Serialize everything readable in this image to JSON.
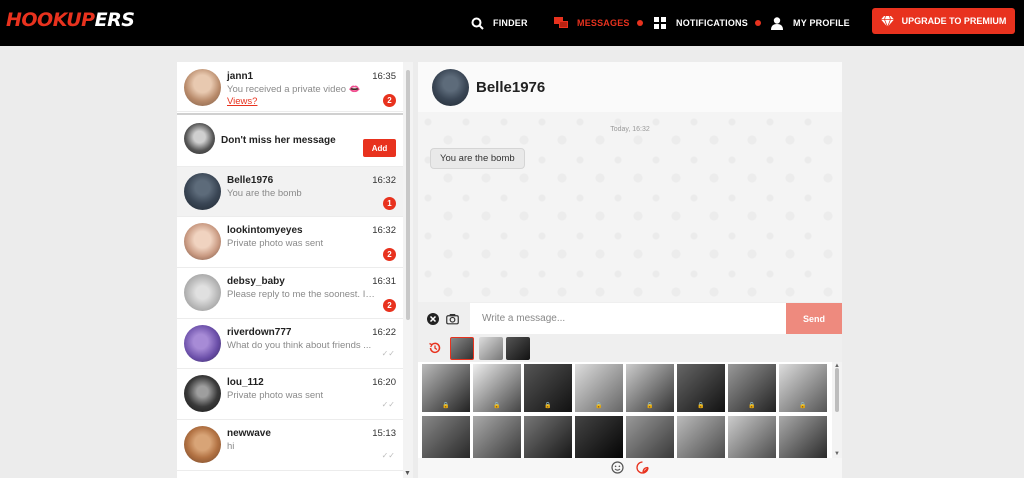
{
  "brand": {
    "logo_part1": "HOOKUP",
    "logo_part2": "ERS"
  },
  "nav": {
    "finder": "FINDER",
    "messages": "MESSAGES",
    "notifications": "NOTIFICATIONS",
    "profile": "MY PROFILE",
    "upgrade": "UPGRADE TO PREMIUM"
  },
  "conversations": [
    {
      "name": "jann1",
      "preview": "You received a private video",
      "link": "Views?",
      "time": "16:35",
      "badge": "2"
    },
    {
      "name": "Don't miss her message",
      "button": "Add"
    },
    {
      "name": "Belle1976",
      "preview": "You are the bomb",
      "time": "16:32",
      "badge": "1"
    },
    {
      "name": "lookintomyeyes",
      "preview": "Private photo was sent",
      "time": "16:32",
      "badge": "2"
    },
    {
      "name": "debsy_baby",
      "preview": "Please reply to me the soonest. I ...",
      "time": "16:31",
      "badge": "2"
    },
    {
      "name": "riverdown777",
      "preview": "What do you think about friends ...",
      "time": "16:22"
    },
    {
      "name": "lou_112",
      "preview": "Private photo was sent",
      "time": "16:20"
    },
    {
      "name": "newwave",
      "preview": "hi",
      "time": "15:13"
    }
  ],
  "chat": {
    "contact": "Belle1976",
    "timestamp": "Today, 16:32",
    "message": "You are the bomb",
    "input_placeholder": "Write a message...",
    "send": "Send"
  },
  "colors": {
    "accent": "#e8321e",
    "send_disabled": "#ee8a7e"
  }
}
